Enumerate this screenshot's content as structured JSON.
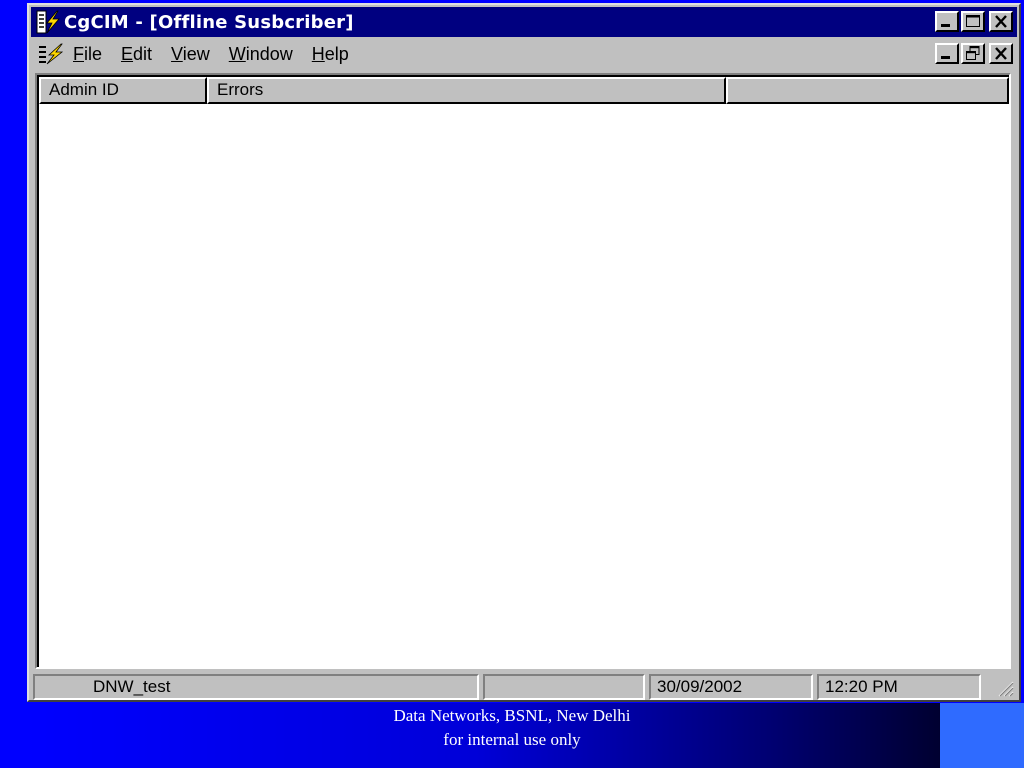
{
  "window": {
    "title": "CgCIM - [Offline Susbcriber]"
  },
  "menu": {
    "items": [
      {
        "accel": "F",
        "rest": "ile"
      },
      {
        "accel": "E",
        "rest": "dit"
      },
      {
        "accel": "V",
        "rest": "iew"
      },
      {
        "accel": "W",
        "rest": "indow"
      },
      {
        "accel": "H",
        "rest": "elp"
      }
    ]
  },
  "list": {
    "columns": [
      "Admin ID",
      "Errors",
      ""
    ]
  },
  "status": {
    "user": "DNW_test",
    "blank": "",
    "date": "30/09/2002",
    "time": "12:20 PM"
  },
  "footer": {
    "line1": "Data Networks, BSNL, New Delhi",
    "line2": "for internal use only"
  },
  "colors": {
    "background": "#0000ff",
    "titlebar": "#000080",
    "face": "#c0c0c0",
    "accent_square": "#2f6bff"
  },
  "icons": {
    "app": "database-lightning-icon",
    "doc": "database-lightning-icon",
    "minimize": "minimize-icon",
    "maximize": "maximize-icon",
    "restore": "restore-icon",
    "close": "close-icon",
    "grip": "resize-grip-icon"
  }
}
